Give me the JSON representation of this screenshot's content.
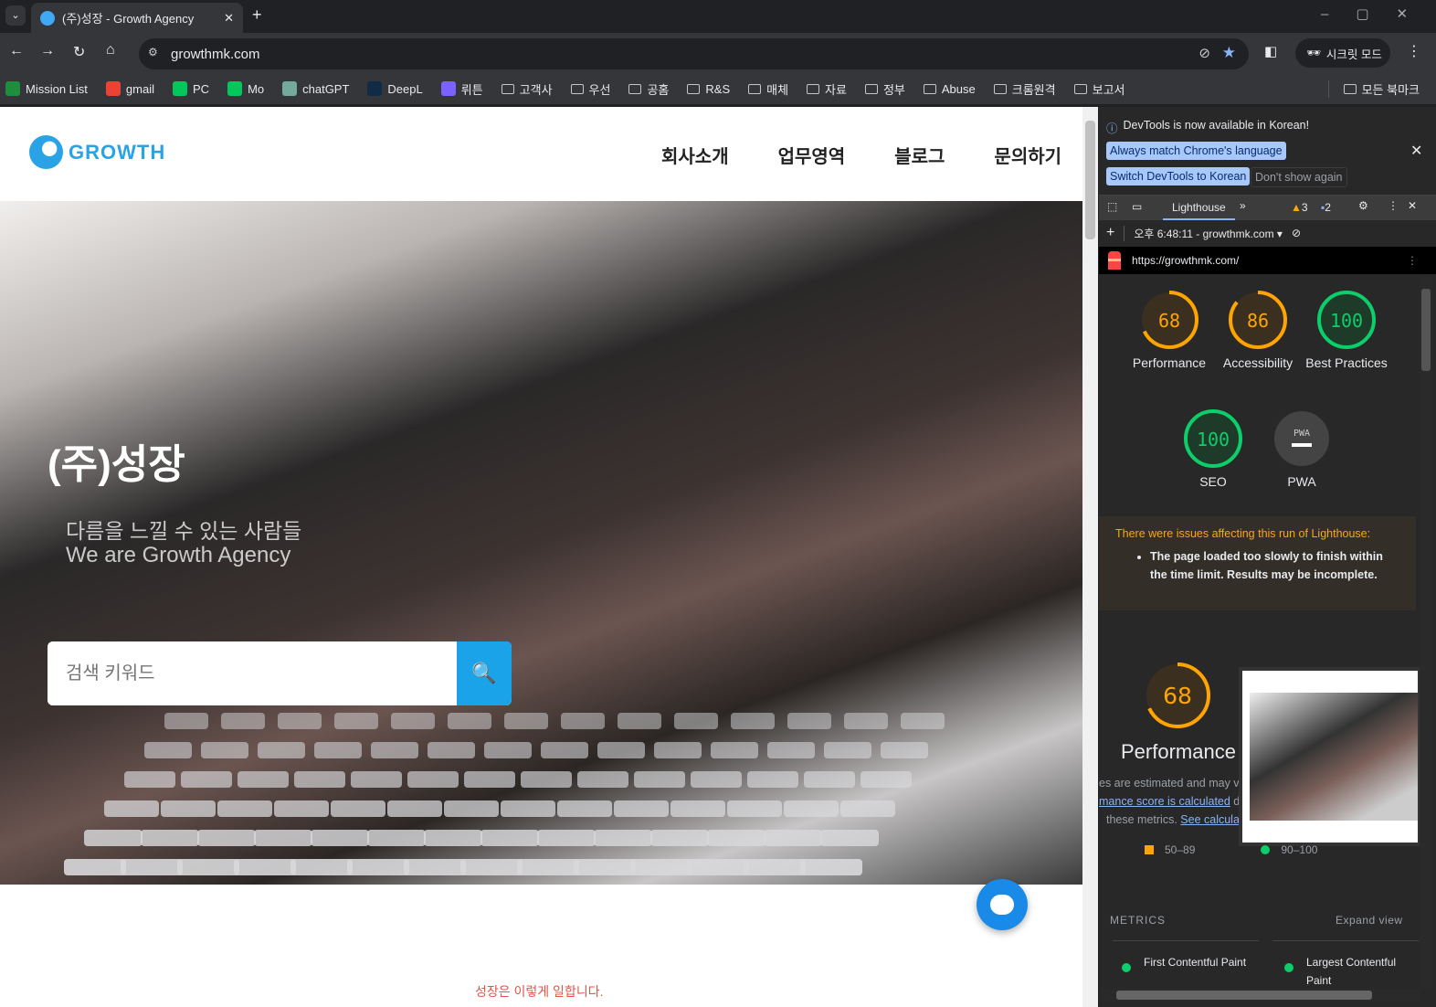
{
  "browser": {
    "tab_title": "(주)성장 - Growth Agency",
    "url": "growthmk.com",
    "incognito_label": "시크릿 모드",
    "bookmarks": [
      "Mission List",
      "gmail",
      "PC",
      "Mo",
      "chatGPT",
      "DeepL",
      "뤼튼",
      "고객사",
      "우선",
      "공홈",
      "R&S",
      "매체",
      "자료",
      "정부",
      "Abuse",
      "크롬원격",
      "보고서"
    ],
    "all_bookmarks": "모든 북마크"
  },
  "site": {
    "logo": "GROWTH",
    "nav": [
      "회사소개",
      "업무영역",
      "블로그",
      "문의하기"
    ],
    "hero_title": "(주)성장",
    "hero_sub1": "다름을 느낄 수 있는 사람들",
    "hero_sub2": "We are Growth Agency",
    "search_placeholder": "검색 키워드",
    "section_caption": "성장은 이렇게 일합니다."
  },
  "devtools": {
    "notice": "DevTools is now available in Korean!",
    "btn_match": "Always match Chrome's language",
    "btn_switch": "Switch DevTools to Korean",
    "btn_dont": "Don't show again",
    "panel_tab": "Lighthouse",
    "warnings": "3",
    "messages": "2",
    "report_select": "오후 6:48:11 - growthmk.com",
    "report_url": "https://growthmk.com/",
    "scores": [
      {
        "label": "Performance",
        "value": 68,
        "color": "#ffa400"
      },
      {
        "label": "Accessibility",
        "value": 86,
        "color": "#ffa400"
      },
      {
        "label": "Best Practices",
        "value": 100,
        "color": "#0cce6b"
      },
      {
        "label": "SEO",
        "value": 100,
        "color": "#0cce6b"
      },
      {
        "label": "PWA",
        "value": "PWA",
        "color": "#9aa0a6"
      }
    ],
    "issue_title": "There were issues affecting this run of Lighthouse:",
    "issue_item": "The page loaded too slowly to finish within the time limit. Results may be incomplete.",
    "perf_score": "68",
    "perf_title": "Performance",
    "desc1": "es are estimated and may va",
    "desc_link1": "mance score is calculated",
    "desc2": " dire",
    "desc3": "these metrics. ",
    "desc_link2": "See calculato",
    "legend_mid": "50–89",
    "legend_high": "90–100",
    "metrics_label": "METRICS",
    "expand": "Expand view",
    "metric1": "First Contentful Paint",
    "metric2": "Largest Contentful Paint"
  }
}
